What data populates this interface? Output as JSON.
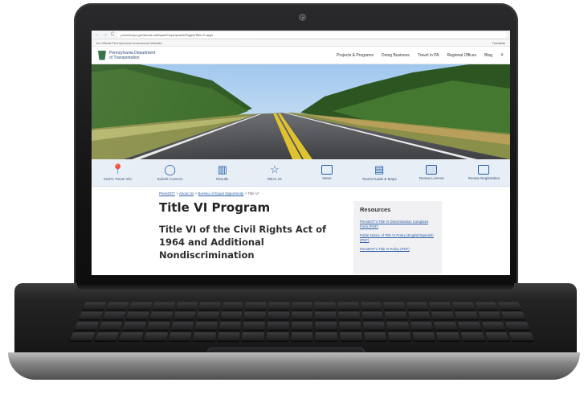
{
  "browser": {
    "url": "penndot.pa.gov/about-us/Equal-Employment/Pages/Title-VI.aspx",
    "nav_back": "←",
    "nav_forward": "→",
    "nav_reload": "C"
  },
  "gov_banner": {
    "text": "An Official Pennsylvania Government Website",
    "translate": "Translate"
  },
  "header": {
    "agency": "Pennsylvania Department of Transportation",
    "nav": [
      "Projects & Programs",
      "Doing Business",
      "Travel in PA",
      "Regional Offices",
      "Blog"
    ],
    "search_icon": "search-icon"
  },
  "quicklinks": [
    {
      "label": "511PA Travel Info",
      "icon": "map-pin-icon",
      "glyph": "⚲"
    },
    {
      "label": "Submit Concern",
      "icon": "chat-bubble-icon",
      "glyph": "💬"
    },
    {
      "label": "Results",
      "icon": "bar-chart-icon",
      "glyph": "📊"
    },
    {
      "label": "REAL ID",
      "icon": "star-icon",
      "glyph": "☆"
    },
    {
      "label": "News",
      "icon": "newspaper-icon",
      "glyph": ""
    },
    {
      "label": "Tourist Guide & Maps",
      "icon": "map-icon",
      "glyph": ""
    },
    {
      "label": "Renew License",
      "icon": "id-card-icon",
      "glyph": ""
    },
    {
      "label": "Renew Registration",
      "icon": "registration-icon",
      "glyph": ""
    }
  ],
  "breadcrumb": {
    "items": [
      "PennDOT",
      "About Us",
      "Bureau of Equal Opportunity"
    ],
    "current": "Title VI"
  },
  "main": {
    "title": "Title VI Program",
    "subtitle_line1": "Title VI of the Civil Rights Act of",
    "subtitle_line2": "1964 and Additional",
    "subtitle_line3": "Nondiscrimination"
  },
  "resources": {
    "title": "Resources",
    "links": [
      "PennDOT's Title VI Discrimination Complaint Form (PDF)",
      "Public Notice of Title VI Policy (English/Spanish) (PDF)",
      "PennDOT's Title VI Policy (PDF)"
    ]
  },
  "colors": {
    "accent": "#1f5fa8",
    "quicklink_bg": "#e8eef6",
    "laptop": "#151516"
  }
}
